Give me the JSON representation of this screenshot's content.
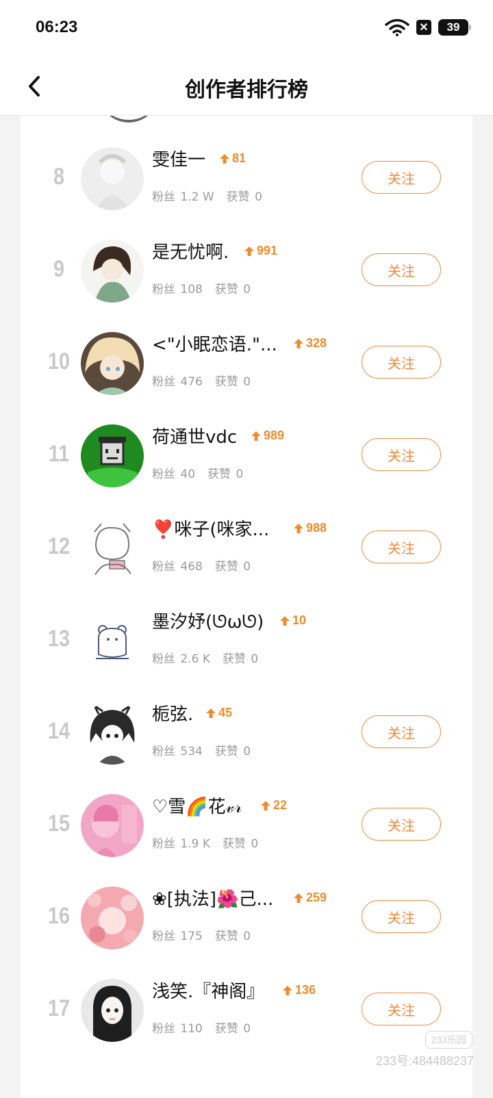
{
  "status_bar": {
    "time": "06:23",
    "battery": "39"
  },
  "header": {
    "title": "创作者排行榜"
  },
  "list": {
    "fans_label": "粉丝",
    "likes_label": "获赞",
    "follow_label": "关注",
    "items": [
      {
        "rank": "8",
        "name": "雯佳一",
        "rise": "81",
        "fans": "1.2 W",
        "likes": "0",
        "show_follow": true
      },
      {
        "rank": "9",
        "name": "是无忧啊.",
        "rise": "991",
        "fans": "108",
        "likes": "0",
        "show_follow": true
      },
      {
        "rank": "10",
        "name": "<\"小眠恋语.\"...",
        "rise": "328",
        "fans": "476",
        "likes": "0",
        "show_follow": true
      },
      {
        "rank": "11",
        "name": "荷通世vdc",
        "rise": "989",
        "fans": "40",
        "likes": "0",
        "show_follow": true
      },
      {
        "rank": "12",
        "name": "❣️咪子(咪家...",
        "rise": "988",
        "fans": "468",
        "likes": "0",
        "show_follow": true
      },
      {
        "rank": "13",
        "name": "墨汐妤(ᘎωᘎ)",
        "rise": "10",
        "fans": "2.6 K",
        "likes": "0",
        "show_follow": false
      },
      {
        "rank": "14",
        "name": "栀弦.",
        "rise": "45",
        "fans": "534",
        "likes": "0",
        "show_follow": true
      },
      {
        "rank": "15",
        "name": "♡雪🌈花𝓋𝓇",
        "rise": "22",
        "fans": "1.9 K",
        "likes": "0",
        "show_follow": true
      },
      {
        "rank": "16",
        "name": "❀[执法]🌺己...",
        "rise": "259",
        "fans": "175",
        "likes": "0",
        "show_follow": true
      },
      {
        "rank": "17",
        "name": "浅笑.『神阁』",
        "rise": "136",
        "fans": "110",
        "likes": "0",
        "show_follow": true
      }
    ]
  },
  "watermark": {
    "logo": "233乐园",
    "id": "233号:484488237"
  },
  "colors": {
    "accent": "#f0883a",
    "rank_gray": "#c9c9c9"
  }
}
